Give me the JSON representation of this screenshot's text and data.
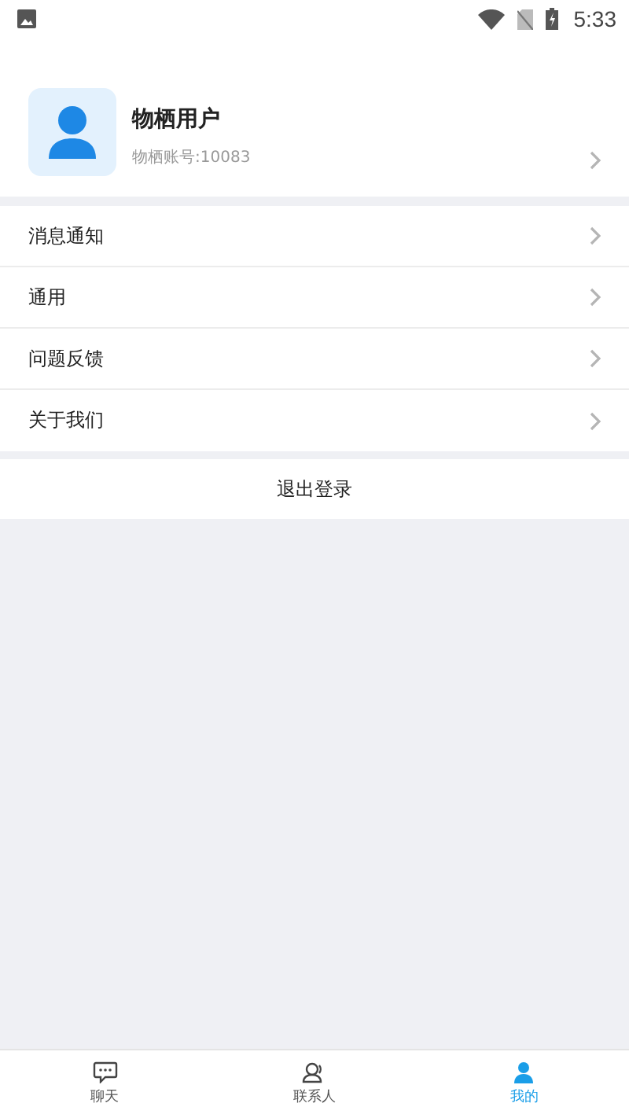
{
  "status_bar": {
    "time": "5:33"
  },
  "profile": {
    "name": "物栖用户",
    "account": "物栖账号:10083"
  },
  "menu": [
    {
      "label": "消息通知"
    },
    {
      "label": "通用"
    },
    {
      "label": "问题反馈"
    },
    {
      "label": "关于我们"
    }
  ],
  "logout": {
    "label": "退出登录"
  },
  "tabs": [
    {
      "kind": "chat",
      "label": "聊天",
      "selected": false
    },
    {
      "kind": "contacts",
      "label": "联系人",
      "selected": false
    },
    {
      "kind": "me",
      "label": "我的",
      "selected": true
    }
  ]
}
